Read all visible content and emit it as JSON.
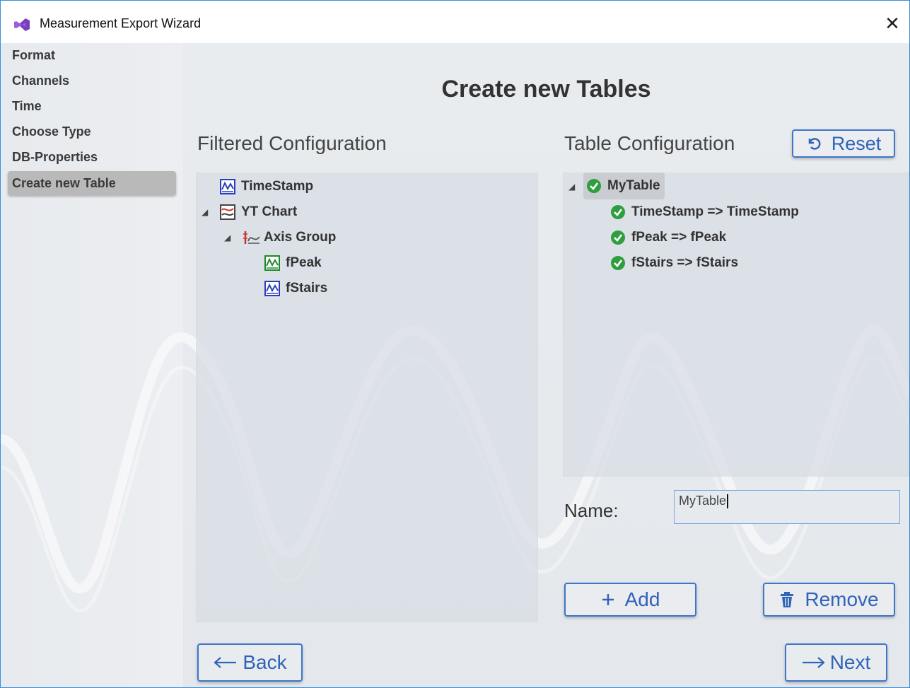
{
  "window": {
    "title": "Measurement Export Wizard",
    "close_glyph": "✕"
  },
  "sidebar": {
    "items": [
      {
        "label": "Format"
      },
      {
        "label": "Channels"
      },
      {
        "label": "Time"
      },
      {
        "label": "Choose Type"
      },
      {
        "label": "DB-Properties"
      },
      {
        "label": "Create new Table",
        "active": true
      }
    ]
  },
  "page": {
    "title": "Create new Tables"
  },
  "filtered": {
    "title": "Filtered Configuration",
    "nodes": [
      {
        "label": "TimeStamp",
        "icon": "channel-icon-blue"
      },
      {
        "label": "YT Chart",
        "icon": "yt-chart-icon",
        "expanded": true
      },
      {
        "label": "Axis Group",
        "icon": "axis-group-icon",
        "expanded": true
      },
      {
        "label": "fPeak",
        "icon": "channel-icon-green"
      },
      {
        "label": "fStairs",
        "icon": "channel-icon-blue"
      }
    ]
  },
  "table_config": {
    "title": "Table Configuration",
    "reset_label": "Reset",
    "root": {
      "label": "MyTable",
      "expanded": true
    },
    "mappings": [
      {
        "label": "TimeStamp => TimeStamp"
      },
      {
        "label": "fPeak => fPeak"
      },
      {
        "label": "fStairs => fStairs"
      }
    ]
  },
  "name_field": {
    "label": "Name:",
    "value": "MyTable"
  },
  "actions": {
    "add_label": "Add",
    "remove_label": "Remove"
  },
  "nav": {
    "back_label": "Back",
    "next_label": "Next"
  },
  "colors": {
    "accent": "#3f76c9",
    "check": "#2e9e3e",
    "window_border": "#3a8fd8"
  }
}
